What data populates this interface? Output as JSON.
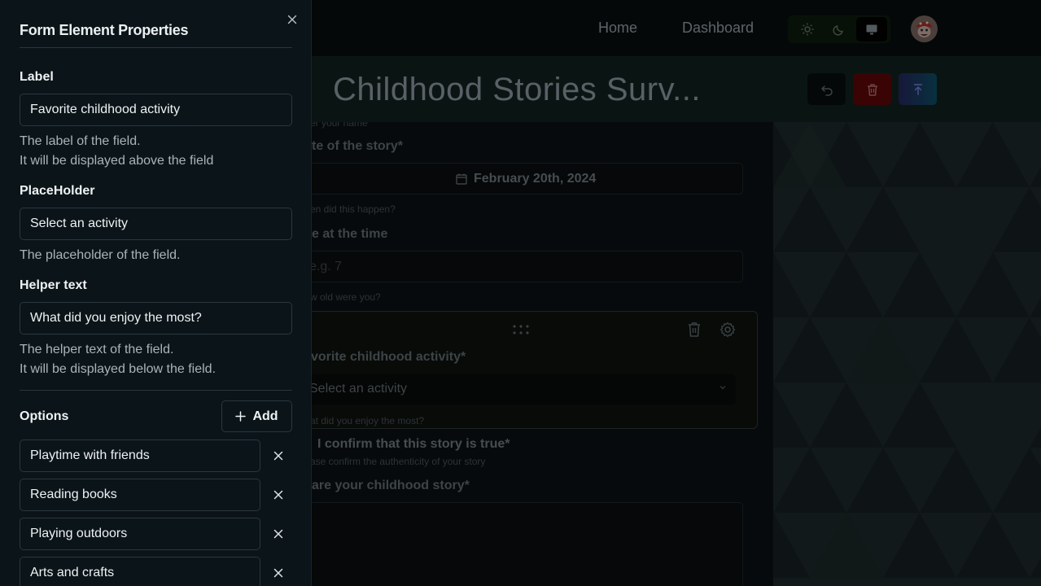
{
  "nav": {
    "home": "Home",
    "dashboard": "Dashboard"
  },
  "header": {
    "form_title": "Childhood Stories Surv..."
  },
  "canvas": {
    "name_helper_partial": "er your name",
    "date_label_partial": "te of the story*",
    "date_value": "February 20th, 2024",
    "date_helper_partial": "en did this happen?",
    "age_label_partial": "e at the time",
    "age_placeholder_partial": "e.g. 7",
    "age_helper_partial": "w old were you?",
    "activity_label_partial": "vorite childhood activity*",
    "activity_placeholder_partial": "Select an activity",
    "activity_helper_partial": "at did you enjoy the most?",
    "confirm_label": "I confirm that this story is true*",
    "confirm_helper_partial": "ase confirm the authenticity of your story",
    "story_label_partial": "are your childhood story*"
  },
  "panel": {
    "title": "Form Element Properties",
    "label_heading": "Label",
    "label_value": "Favorite childhood activity",
    "label_desc_1": "The label of the field.",
    "label_desc_2": "It will be displayed above the field",
    "placeholder_heading": "PlaceHolder",
    "placeholder_value": "Select an activity",
    "placeholder_desc": "The placeholder of the field.",
    "helper_heading": "Helper text",
    "helper_value": "What did you enjoy the most?",
    "helper_desc_1": "The helper text of the field.",
    "helper_desc_2": "It will be displayed below the field.",
    "options_heading": "Options",
    "add_label": "Add",
    "options": [
      {
        "value": "Playtime with friends"
      },
      {
        "value": "Reading books"
      },
      {
        "value": "Playing outdoors"
      },
      {
        "value": "Arts and crafts"
      }
    ]
  },
  "icons": {
    "close": "close-icon",
    "plus": "plus-icon",
    "remove": "x-icon",
    "sun": "sun-icon",
    "moon": "moon-icon",
    "monitor": "monitor-icon",
    "undo": "undo-icon",
    "trash": "trash-icon",
    "publish": "publish-icon",
    "calendar": "calendar-icon",
    "drag": "drag-handle-icon",
    "gear": "gear-icon",
    "chevron": "chevron-down-icon"
  },
  "colors": {
    "panel_bg": "#0b1419",
    "delete_btn": "#3a0405",
    "text_primary": "#eef2f4"
  }
}
